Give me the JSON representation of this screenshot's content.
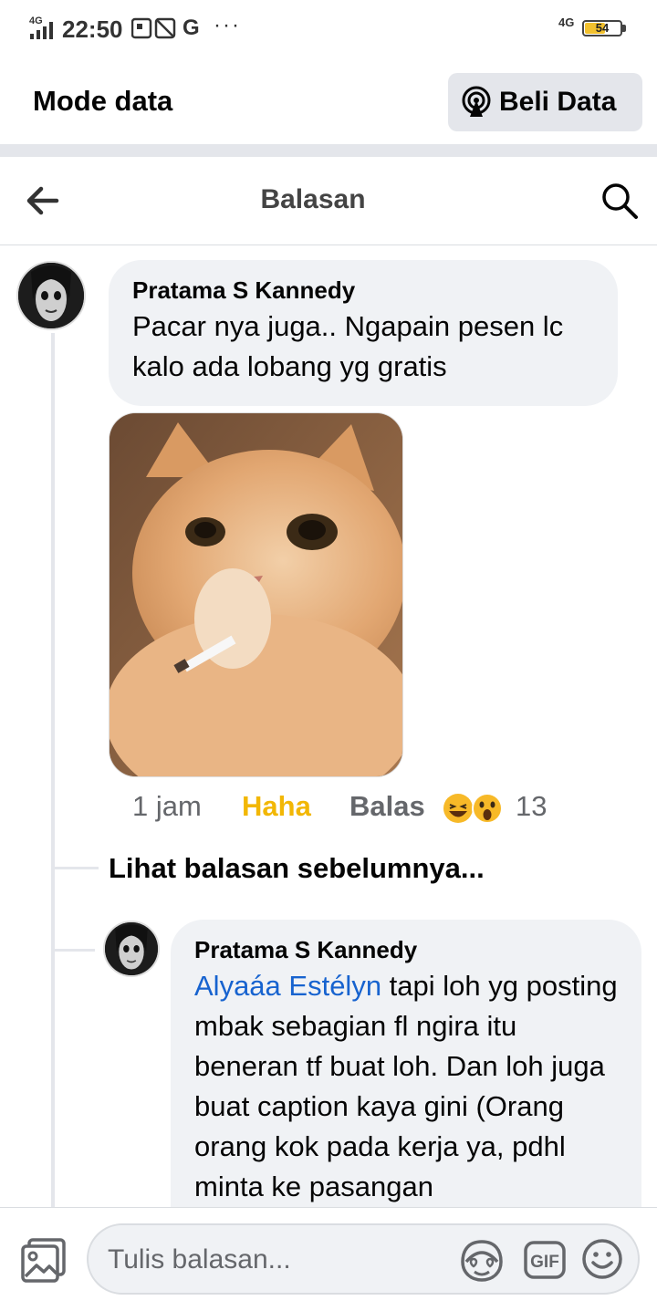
{
  "status_bar": {
    "network": "4G",
    "time": "22:50",
    "carrier_icon": "G",
    "more": "···",
    "right_network": "4G",
    "battery": "54",
    "battery_level": 0.54
  },
  "data_banner": {
    "title": "Mode data",
    "buy_label": "Beli Data",
    "buy_icon": "broadcast-icon"
  },
  "header": {
    "title": "Balasan",
    "back_icon": "arrow-left-icon",
    "search_icon": "search-icon"
  },
  "comment": {
    "author": "Pratama S Kannedy",
    "text": "Pacar nya juga.. Ngapain pesen lc kalo ada lobang yg gratis",
    "time": "1 jam",
    "reaction_label": "Haha",
    "reply_label": "Balas",
    "reaction_icons": [
      "haha-emoji-icon",
      "wow-emoji-icon"
    ],
    "reaction_count": "13"
  },
  "previous_replies": "Lihat balasan sebelumnya...",
  "reply": {
    "author": "Pratama S Kannedy",
    "mention": "Alyaáa Estélyn",
    "text": " tapi loh yg posting mbak sebagian fl ngira itu beneran tf buat loh. Dan loh juga buat caption kaya gini (Orang orang kok pada kerja ya, pdhl minta ke pasangan"
  },
  "composer": {
    "placeholder": "Tulis balasan...",
    "gif_label": "GIF"
  },
  "colors": {
    "accent_link": "#1763cf",
    "haha": "#f2b705",
    "bubble": "#f0f2f5"
  }
}
